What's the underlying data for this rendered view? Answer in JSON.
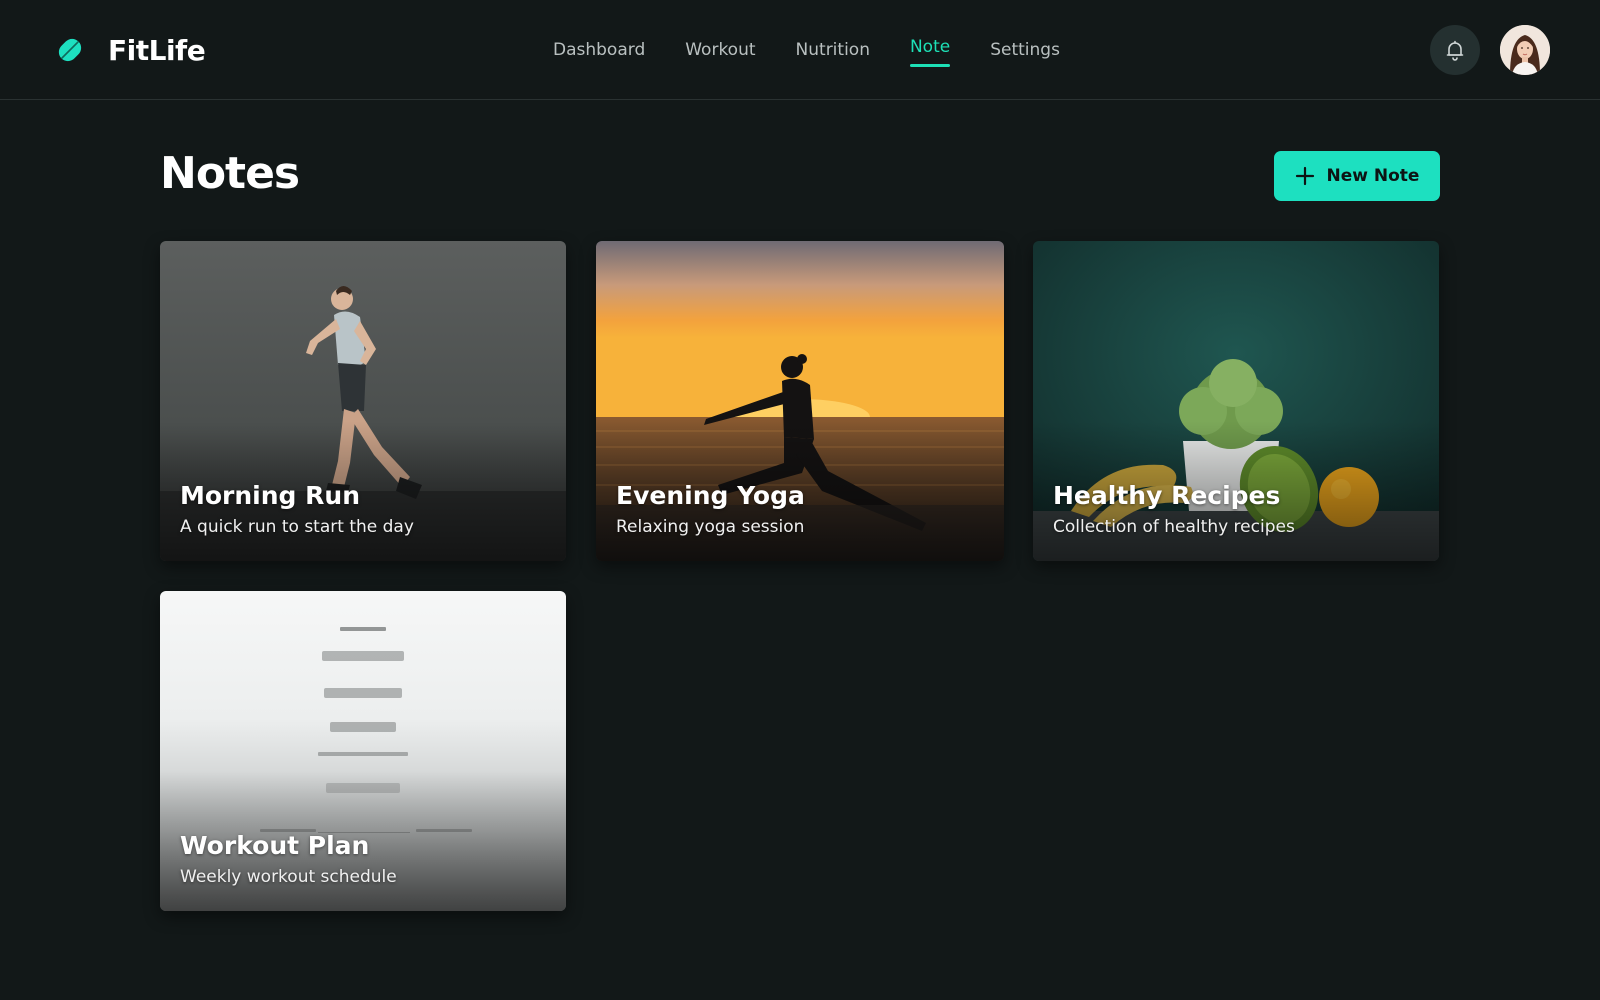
{
  "app": {
    "name": "FitLife",
    "accent_color": "#1de0c0",
    "logo_icon": "leaf-icon"
  },
  "nav": {
    "items": [
      {
        "label": "Dashboard"
      },
      {
        "label": "Workout"
      },
      {
        "label": "Nutrition"
      },
      {
        "label": "Note",
        "active": true
      },
      {
        "label": "Settings"
      }
    ]
  },
  "header": {
    "notification_icon": "bell-icon",
    "avatar_icon": "user-avatar"
  },
  "main": {
    "title": "Notes",
    "new_note_label": "New Note",
    "new_note_icon": "plus-icon"
  },
  "notes": [
    {
      "title": "Morning Run",
      "subtitle": "A quick run to start the day"
    },
    {
      "title": "Evening Yoga",
      "subtitle": "Relaxing yoga session"
    },
    {
      "title": "Healthy Recipes",
      "subtitle": "Collection of healthy recipes"
    },
    {
      "title": "Workout Plan",
      "subtitle": "Weekly workout schedule"
    }
  ]
}
